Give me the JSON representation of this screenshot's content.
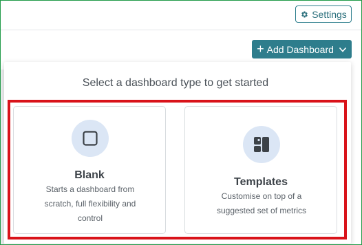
{
  "header": {
    "settings_label": "Settings",
    "settings_icon": "gear-icon"
  },
  "toolbar": {
    "add_dashboard_label": "Add Dashboard",
    "add_icon": "plus-icon",
    "dropdown_icon": "chevron-down-icon"
  },
  "dropdown": {
    "prompt": "Select a dashboard type to get started",
    "options": [
      {
        "title": "Blank",
        "description": "Starts a dashboard from scratch, full flexibility and control",
        "icon": "square-icon"
      },
      {
        "title": "Templates",
        "description": "Customise on top of a suggested set of metrics",
        "icon": "layout-icon"
      }
    ]
  },
  "colors": {
    "accent": "#2e7d8c",
    "highlight": "#d9131a",
    "icon_bg": "#dbe6f5",
    "icon_fg": "#3c4248"
  }
}
